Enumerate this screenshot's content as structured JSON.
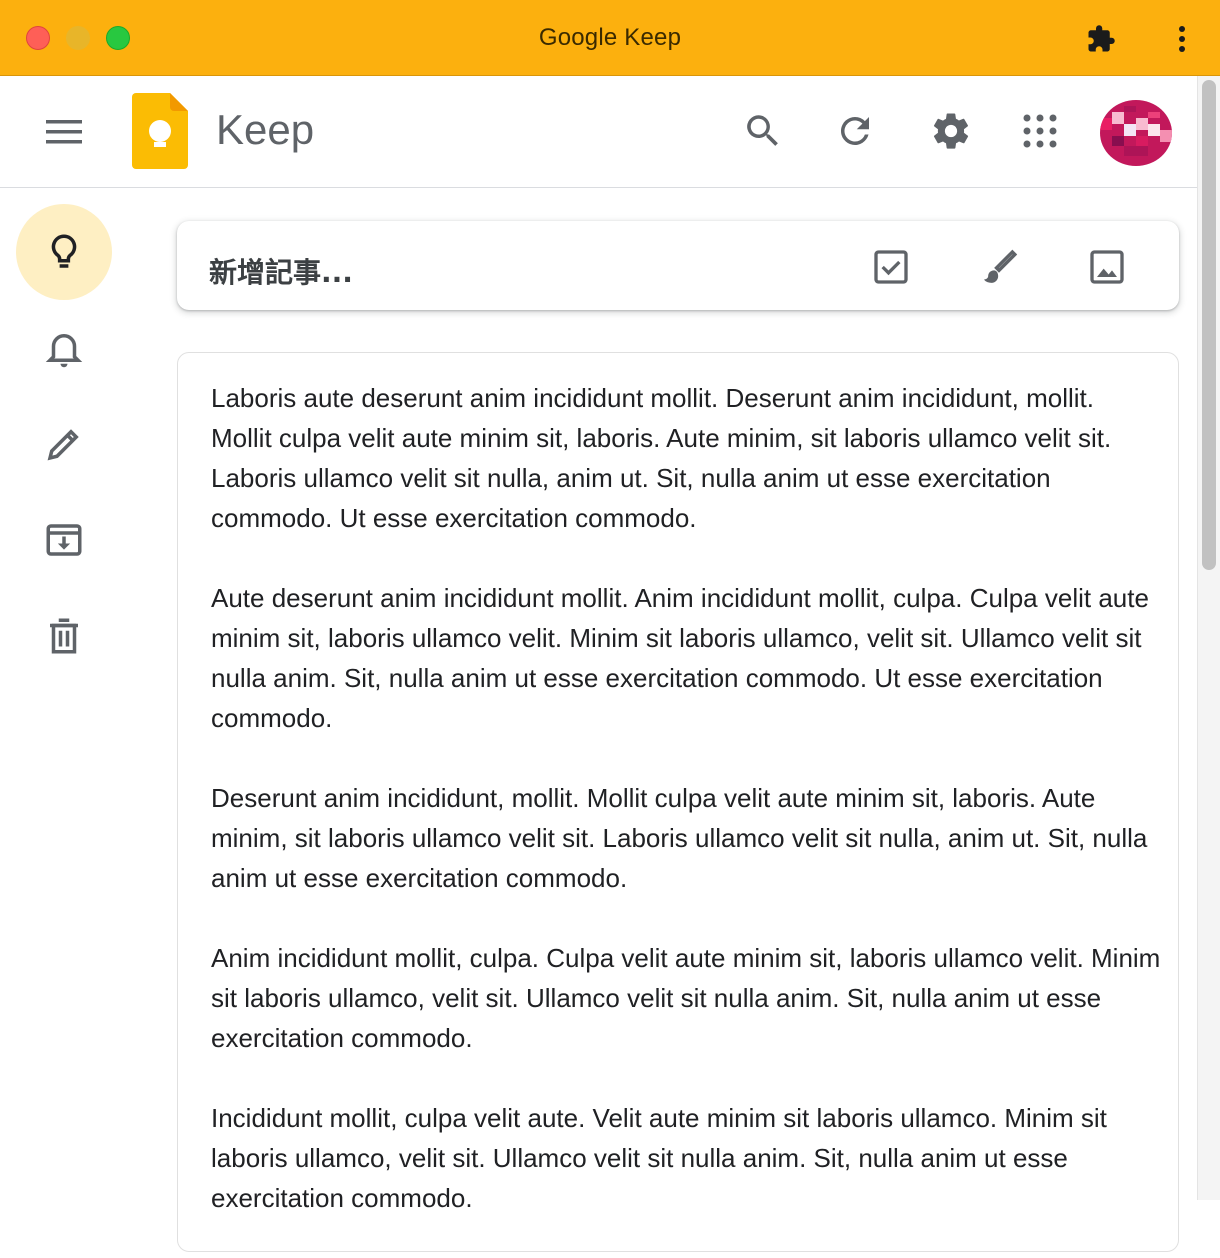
{
  "window": {
    "title": "Google Keep"
  },
  "header": {
    "product_name": "Keep"
  },
  "take_note": {
    "placeholder": "新增記事..."
  },
  "note": {
    "paragraphs": [
      "Laboris aute deserunt anim incididunt mollit. Deserunt anim incididunt, mollit. Mollit culpa velit aute minim sit, laboris. Aute minim, sit laboris ullamco velit sit. Laboris ullamco velit sit nulla, anim ut. Sit, nulla anim ut esse exercitation commodo. Ut esse exercitation commodo.",
      "Aute deserunt anim incididunt mollit. Anim incididunt mollit, culpa. Culpa velit aute minim sit, laboris ullamco velit. Minim sit laboris ullamco, velit sit. Ullamco velit sit nulla anim. Sit, nulla anim ut esse exercitation commodo. Ut esse exercitation commodo.",
      "Deserunt anim incididunt, mollit. Mollit culpa velit aute minim sit, laboris. Aute minim, sit laboris ullamco velit sit. Laboris ullamco velit sit nulla, anim ut. Sit, nulla anim ut esse exercitation commodo.",
      "Anim incididunt mollit, culpa. Culpa velit aute minim sit, laboris ullamco velit. Minim sit laboris ullamco, velit sit. Ullamco velit sit nulla anim. Sit, nulla anim ut esse exercitation commodo.",
      "Incididunt mollit, culpa velit aute. Velit aute minim sit laboris ullamco. Minim sit laboris ullamco, velit sit. Ullamco velit sit nulla anim. Sit, nulla anim ut esse exercitation commodo."
    ]
  },
  "icons": {
    "titlebar": [
      "extension-puzzle-icon",
      "more-vert-icon"
    ],
    "header": [
      "menu-icon",
      "keep-logo-icon",
      "search-icon",
      "refresh-icon",
      "settings-gear-icon",
      "apps-grid-icon",
      "avatar"
    ],
    "nav": [
      "lightbulb-icon",
      "bell-icon",
      "pencil-icon",
      "archive-icon",
      "trash-icon"
    ],
    "take_note": [
      "checkbox-icon",
      "brush-icon",
      "image-icon"
    ]
  },
  "colors": {
    "titlebar": "#fcb00e",
    "nav_active": "#feefc3",
    "logo_yellow": "#fbbc04"
  }
}
